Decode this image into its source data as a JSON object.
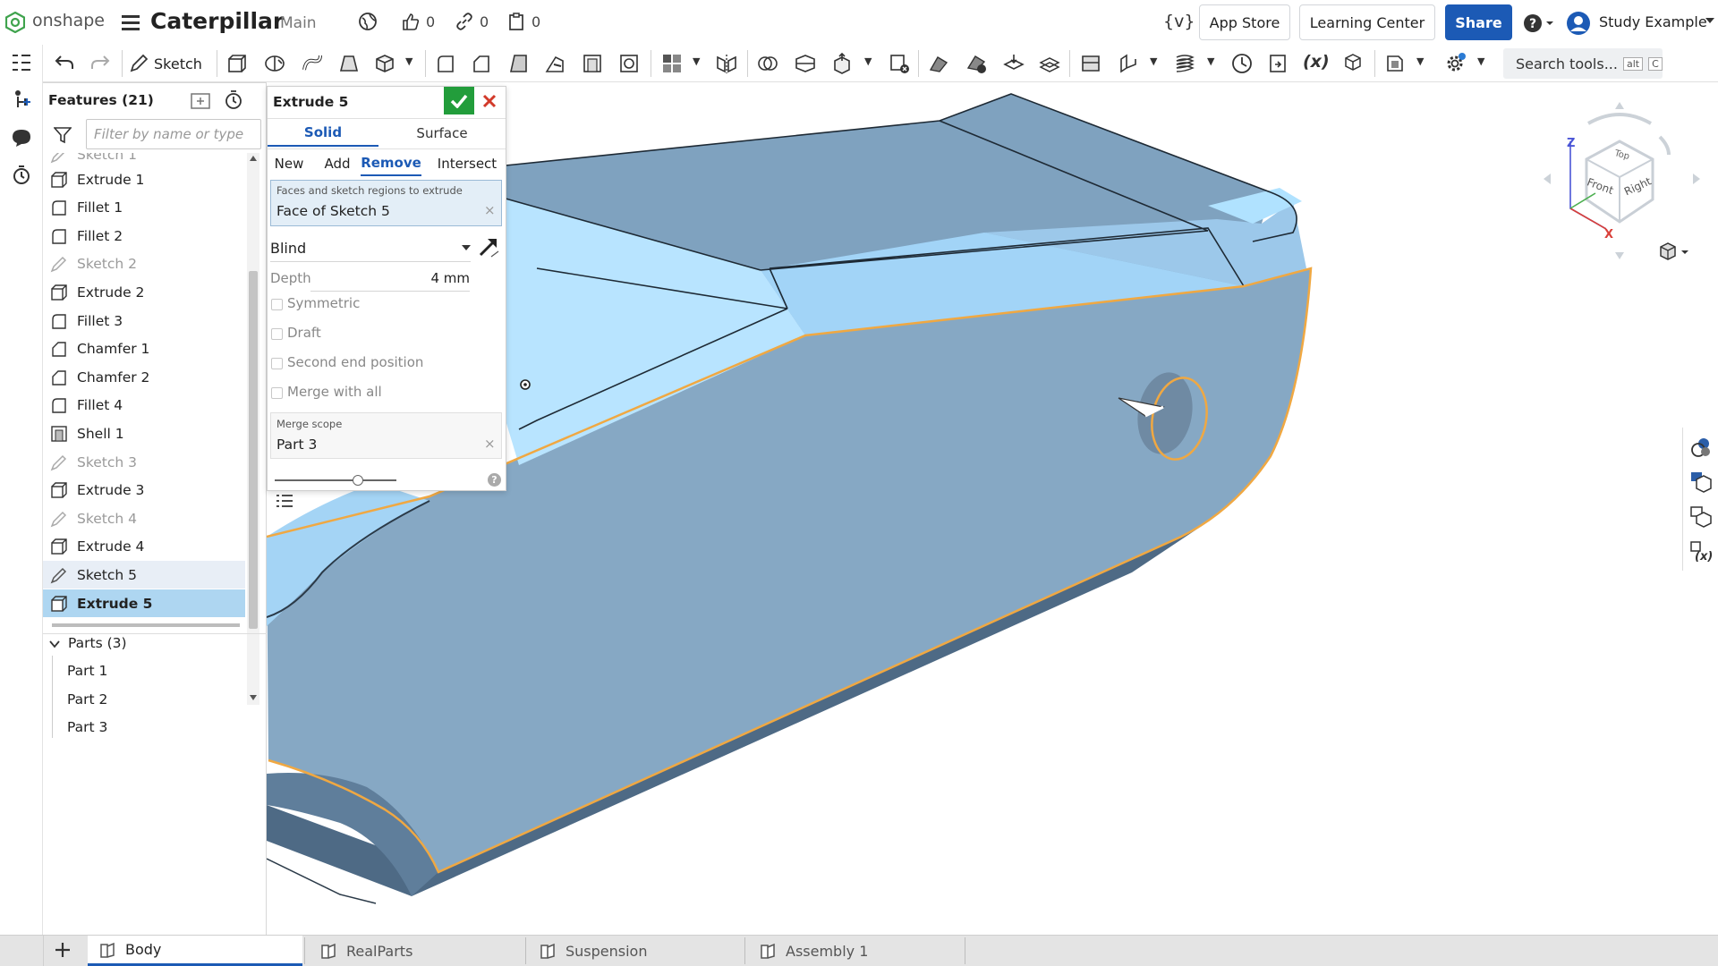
{
  "app": {
    "logo_text": "onshape",
    "document_title": "Caterpillar",
    "branch": "Main",
    "likes_count": "0",
    "links_count": "0",
    "copies_count": "0",
    "variable_icon_label": "{v}",
    "app_store": "App Store",
    "learning_center": "Learning Center",
    "share": "Share",
    "user_name": "Study Example"
  },
  "toolbar": {
    "sketch_label": "Sketch",
    "search_placeholder": "Search tools...",
    "search_shortcut_1": "alt",
    "search_shortcut_2": "C",
    "variable_icon_text": "(x)"
  },
  "features": {
    "header": "Features (21)",
    "filter_placeholder": "Filter by name or type",
    "clipped_item": "Sketch 1",
    "items": [
      {
        "label": "Extrude 1",
        "icon": "extrude-icon",
        "state": "normal"
      },
      {
        "label": "Fillet 1",
        "icon": "fillet-icon",
        "state": "normal"
      },
      {
        "label": "Fillet 2",
        "icon": "fillet-icon",
        "state": "normal"
      },
      {
        "label": "Sketch 2",
        "icon": "sketch-icon",
        "state": "dim"
      },
      {
        "label": "Extrude 2",
        "icon": "extrude-icon",
        "state": "normal"
      },
      {
        "label": "Fillet 3",
        "icon": "fillet-icon",
        "state": "normal"
      },
      {
        "label": "Chamfer 1",
        "icon": "chamfer-icon",
        "state": "normal"
      },
      {
        "label": "Chamfer 2",
        "icon": "chamfer-icon",
        "state": "normal"
      },
      {
        "label": "Fillet 4",
        "icon": "fillet-icon",
        "state": "normal"
      },
      {
        "label": "Shell 1",
        "icon": "shell-icon",
        "state": "normal"
      },
      {
        "label": "Sketch 3",
        "icon": "sketch-icon",
        "state": "dim"
      },
      {
        "label": "Extrude 3",
        "icon": "extrude-icon",
        "state": "normal"
      },
      {
        "label": "Sketch 4",
        "icon": "sketch-icon",
        "state": "dim"
      },
      {
        "label": "Extrude 4",
        "icon": "extrude-icon",
        "state": "normal"
      },
      {
        "label": "Sketch 5",
        "icon": "sketch-icon",
        "state": "rolled"
      },
      {
        "label": "Extrude 5",
        "icon": "extrude-icon",
        "state": "selected"
      }
    ],
    "parts_header": "Parts (3)",
    "parts": [
      "Part 1",
      "Part 2",
      "Part 3"
    ]
  },
  "dialog": {
    "title": "Extrude 5",
    "tab_solid": "Solid",
    "tab_surface": "Surface",
    "op_new": "New",
    "op_add": "Add",
    "op_remove": "Remove",
    "op_intersect": "Intersect",
    "faces_label": "Faces and sketch regions to extrude",
    "faces_value": "Face of Sketch 5",
    "end_type": "Blind",
    "depth_label": "Depth",
    "depth_value": "4 mm",
    "symmetric": "Symmetric",
    "draft": "Draft",
    "second_end": "Second end position",
    "merge_all": "Merge with all",
    "merge_scope_label": "Merge scope",
    "merge_scope_value": "Part 3",
    "help": "?"
  },
  "viewcube": {
    "top": "Top",
    "front": "Front",
    "right": "Right",
    "axis_z": "Z",
    "axis_x": "X"
  },
  "tabs": [
    {
      "label": "Body",
      "active": true
    },
    {
      "label": "RealParts",
      "active": false
    },
    {
      "label": "Suspension",
      "active": false
    },
    {
      "label": "Assembly 1",
      "active": false
    }
  ],
  "colors": {
    "brand_blue": "#1c5ab5",
    "confirm_green": "#229d3b",
    "cancel_red": "#d23a2a",
    "model_face": "#86a9c6",
    "model_highlight": "#a9dcff",
    "selection_edge": "#f0a842"
  }
}
